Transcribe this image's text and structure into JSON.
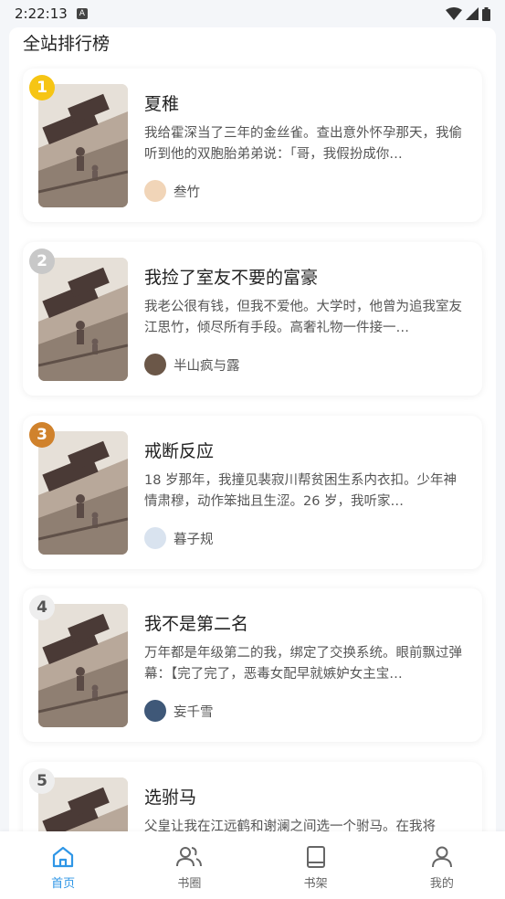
{
  "status": {
    "time": "2:22:13",
    "a_badge": "A"
  },
  "ranking": {
    "title": "全站排行榜",
    "items": [
      {
        "rank": "1",
        "title": "夏稚",
        "desc": "我给霍深当了三年的金丝雀。查出意外怀孕那天，我偷听到他的双胞胎弟弟说：「哥，我假扮成你…",
        "author": "叁竹",
        "avatar_color": "#f1d5b8"
      },
      {
        "rank": "2",
        "title": "我捡了室友不要的富豪",
        "desc": "我老公很有钱，但我不爱他。大学时，他曾为追我室友江思竹，倾尽所有手段。高奢礼物一件接一…",
        "author": "半山疯与露",
        "avatar_color": "#6b5748"
      },
      {
        "rank": "3",
        "title": "戒断反应",
        "desc": "18 岁那年，我撞见裴寂川帮贫困生系内衣扣。少年神情肃穆，动作笨拙且生涩。26 岁，我听家…",
        "author": "暮子规",
        "avatar_color": "#d9e3ef"
      },
      {
        "rank": "4",
        "title": "我不是第二名",
        "desc": "万年都是年级第二的我，绑定了交换系统。眼前飘过弹幕：【完了完了，恶毒女配早就嫉妒女主宝…",
        "author": "妄千雪",
        "avatar_color": "#3f5878"
      },
      {
        "rank": "5",
        "title": "选驸马",
        "desc": "父皇让我在江远鹤和谢澜之间选一个驸马。在我将",
        "author": "",
        "avatar_color": "#cccccc"
      }
    ]
  },
  "tabbar": {
    "items": [
      {
        "label": "首页",
        "icon": "home-icon",
        "active": true
      },
      {
        "label": "书圈",
        "icon": "people-icon",
        "active": false
      },
      {
        "label": "书架",
        "icon": "book-icon",
        "active": false
      },
      {
        "label": "我的",
        "icon": "user-icon",
        "active": false
      }
    ]
  },
  "colors": {
    "accent": "#2f96e6",
    "rank1": "#f6c514",
    "rank2": "#c8c8c8",
    "rank3": "#d0822c"
  }
}
